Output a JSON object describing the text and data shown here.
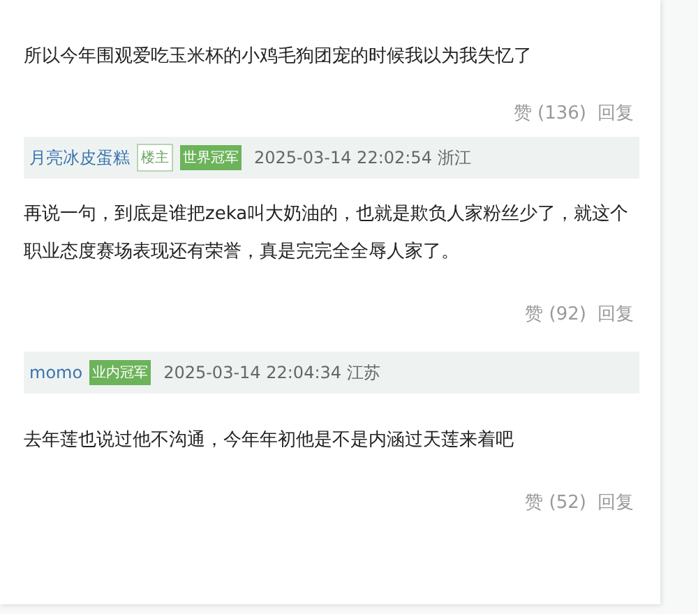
{
  "comments": [
    {
      "text": "所以今年围观爱吃玉米杯的小鸡毛狗团宠的时候我以为我失忆了",
      "likes": "赞 (136)",
      "reply": "回复"
    },
    {
      "author": "月亮冰皮蛋糕",
      "badges": [
        {
          "kind": "owner",
          "label": "楼主"
        },
        {
          "kind": "rank",
          "label": "世界冠军"
        }
      ],
      "time": "2025-03-14 22:02:54 浙江",
      "text": "再说一句，到底是谁把zeka叫大奶油的，也就是欺负人家粉丝少了，就这个职业态度赛场表现还有荣誉，真是完完全全辱人家了。",
      "likes": "赞 (92)",
      "reply": "回复"
    },
    {
      "author": "momo",
      "badges": [
        {
          "kind": "rank",
          "label": "业内冠军"
        }
      ],
      "time": "2025-03-14 22:04:34 江苏",
      "text": "去年莲也说过他不沟通，今年年初他是不是内涵过天莲来着吧",
      "likes": "赞 (52)",
      "reply": "回复"
    }
  ]
}
